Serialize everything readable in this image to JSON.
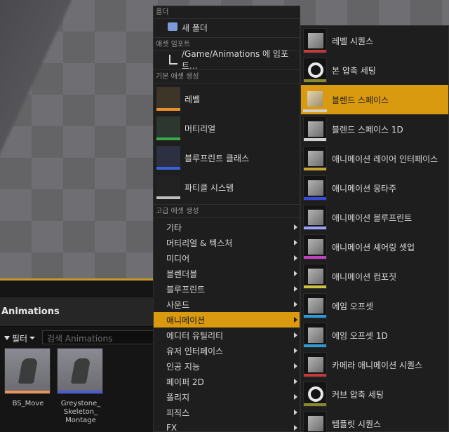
{
  "menu": {
    "section_folder": "폴더",
    "new_folder": "새 폴더",
    "section_import": "애셋 임포트",
    "import_to": "/Game/Animations 에 임포트...",
    "section_basic": "기본 애셋 생성",
    "basic_items": [
      "레벨",
      "머티리얼",
      "블루프린트 클래스",
      "파티클 시스템"
    ],
    "section_advanced": "고급 에셋 생성",
    "advanced_items": [
      "기타",
      "머티리얼 & 텍스처",
      "미디어",
      "블렌더블",
      "블루프린트",
      "사운드",
      "애니메이션",
      "에디터 유틸리티",
      "유저 인터페이스",
      "인공 지능",
      "페이퍼 2D",
      "폴리지",
      "피직스",
      "FX"
    ],
    "highlight_color": "#d99a10"
  },
  "submenu": {
    "items": [
      "레벨 시퀀스",
      "본 압축 세팅",
      "블렌드 스페이스",
      "블렌드 스페이스 1D",
      "애니메이션 레이어 인터페이스",
      "애니메이션 몽타주",
      "애니메이션 블루프린트",
      "애니메이션 셰어링 셋업",
      "애니메이션 컴포짓",
      "에임 오프셋",
      "에임 오프셋 1D",
      "카메라 애니메이션 시퀀스",
      "커브 압축 세팅",
      "템플릿 시퀀스"
    ],
    "highlighted": "블렌드 스페이스"
  },
  "content_browser": {
    "title": "Animations",
    "filter_label": "필터",
    "search_placeholder": "검색 Animations",
    "assets": [
      {
        "label": "BS_Move",
        "accent": "#e8945a"
      },
      {
        "label": "Greystone_\nSkeleton_\nMontage",
        "accent": "#4a5cd8"
      }
    ]
  }
}
